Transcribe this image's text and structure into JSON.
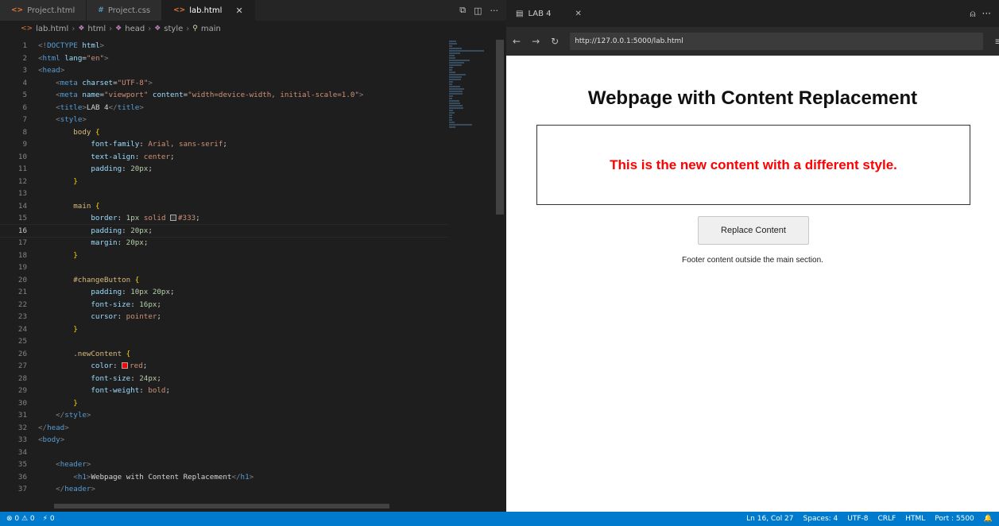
{
  "editor": {
    "tabs": [
      {
        "label": "Project.html",
        "type": "html",
        "active": false
      },
      {
        "label": "Project.css",
        "type": "css",
        "active": false
      },
      {
        "label": "lab.html",
        "type": "html",
        "active": true
      }
    ],
    "breadcrumb": [
      "lab.html",
      "html",
      "head",
      "style",
      "main"
    ],
    "current_line": 16,
    "lines": [
      [
        {
          "c": "tk-punc",
          "t": "<!"
        },
        {
          "c": "tk-tag",
          "t": "DOCTYPE"
        },
        {
          "c": "tk-attr",
          "t": " html"
        },
        {
          "c": "tk-punc",
          "t": ">"
        }
      ],
      [
        {
          "c": "tk-punc",
          "t": "<"
        },
        {
          "c": "tk-tag",
          "t": "html"
        },
        {
          "c": "tk-attr",
          "t": " lang"
        },
        {
          "c": "tk-text",
          "t": "="
        },
        {
          "c": "tk-str",
          "t": "\"en\""
        },
        {
          "c": "tk-punc",
          "t": ">"
        }
      ],
      [
        {
          "c": "tk-punc",
          "t": "<"
        },
        {
          "c": "tk-tag",
          "t": "head"
        },
        {
          "c": "tk-punc",
          "t": ">"
        }
      ],
      [
        {
          "c": "tk-text",
          "t": "    "
        },
        {
          "c": "tk-punc",
          "t": "<"
        },
        {
          "c": "tk-tag",
          "t": "meta"
        },
        {
          "c": "tk-attr",
          "t": " charset"
        },
        {
          "c": "tk-text",
          "t": "="
        },
        {
          "c": "tk-str",
          "t": "\"UTF-8\""
        },
        {
          "c": "tk-punc",
          "t": ">"
        }
      ],
      [
        {
          "c": "tk-text",
          "t": "    "
        },
        {
          "c": "tk-punc",
          "t": "<"
        },
        {
          "c": "tk-tag",
          "t": "meta"
        },
        {
          "c": "tk-attr",
          "t": " name"
        },
        {
          "c": "tk-text",
          "t": "="
        },
        {
          "c": "tk-str",
          "t": "\"viewport\""
        },
        {
          "c": "tk-attr",
          "t": " content"
        },
        {
          "c": "tk-text",
          "t": "="
        },
        {
          "c": "tk-str",
          "t": "\"width=device-width, initial-scale=1.0\""
        },
        {
          "c": "tk-punc",
          "t": ">"
        }
      ],
      [
        {
          "c": "tk-text",
          "t": "    "
        },
        {
          "c": "tk-punc",
          "t": "<"
        },
        {
          "c": "tk-tag",
          "t": "title"
        },
        {
          "c": "tk-punc",
          "t": ">"
        },
        {
          "c": "tk-text",
          "t": "LAB 4"
        },
        {
          "c": "tk-punc",
          "t": "</"
        },
        {
          "c": "tk-tag",
          "t": "title"
        },
        {
          "c": "tk-punc",
          "t": ">"
        }
      ],
      [
        {
          "c": "tk-text",
          "t": "    "
        },
        {
          "c": "tk-punc",
          "t": "<"
        },
        {
          "c": "tk-tag",
          "t": "style"
        },
        {
          "c": "tk-punc",
          "t": ">"
        }
      ],
      [
        {
          "c": "tk-text",
          "t": "        "
        },
        {
          "c": "tk-sel",
          "t": "body"
        },
        {
          "c": "tk-text",
          "t": " "
        },
        {
          "c": "tk-brace",
          "t": "{"
        }
      ],
      [
        {
          "c": "tk-text",
          "t": "            "
        },
        {
          "c": "tk-prop",
          "t": "font-family"
        },
        {
          "c": "tk-text",
          "t": ": "
        },
        {
          "c": "tk-val",
          "t": "Arial, sans-serif"
        },
        {
          "c": "tk-text",
          "t": ";"
        }
      ],
      [
        {
          "c": "tk-text",
          "t": "            "
        },
        {
          "c": "tk-prop",
          "t": "text-align"
        },
        {
          "c": "tk-text",
          "t": ": "
        },
        {
          "c": "tk-val",
          "t": "center"
        },
        {
          "c": "tk-text",
          "t": ";"
        }
      ],
      [
        {
          "c": "tk-text",
          "t": "            "
        },
        {
          "c": "tk-prop",
          "t": "padding"
        },
        {
          "c": "tk-text",
          "t": ": "
        },
        {
          "c": "tk-num",
          "t": "20px"
        },
        {
          "c": "tk-text",
          "t": ";"
        }
      ],
      [
        {
          "c": "tk-text",
          "t": "        "
        },
        {
          "c": "tk-brace",
          "t": "}"
        }
      ],
      [
        {
          "c": "tk-text",
          "t": ""
        }
      ],
      [
        {
          "c": "tk-text",
          "t": "        "
        },
        {
          "c": "tk-sel",
          "t": "main"
        },
        {
          "c": "tk-text",
          "t": " "
        },
        {
          "c": "tk-brace",
          "t": "{"
        }
      ],
      [
        {
          "c": "tk-text",
          "t": "            "
        },
        {
          "c": "tk-prop",
          "t": "border"
        },
        {
          "c": "tk-text",
          "t": ": "
        },
        {
          "c": "tk-num",
          "t": "1px"
        },
        {
          "c": "tk-val",
          "t": " solid "
        },
        {
          "c": "sw",
          "t": "#333"
        },
        {
          "c": "tk-val",
          "t": "#333"
        },
        {
          "c": "tk-text",
          "t": ";"
        }
      ],
      [
        {
          "c": "tk-text",
          "t": "            "
        },
        {
          "c": "tk-prop",
          "t": "padding"
        },
        {
          "c": "tk-text",
          "t": ": "
        },
        {
          "c": "tk-num",
          "t": "20px"
        },
        {
          "c": "tk-text",
          "t": ";"
        }
      ],
      [
        {
          "c": "tk-text",
          "t": "            "
        },
        {
          "c": "tk-prop",
          "t": "margin"
        },
        {
          "c": "tk-text",
          "t": ": "
        },
        {
          "c": "tk-num",
          "t": "20px"
        },
        {
          "c": "tk-text",
          "t": ";"
        }
      ],
      [
        {
          "c": "tk-text",
          "t": "        "
        },
        {
          "c": "tk-brace",
          "t": "}"
        }
      ],
      [
        {
          "c": "tk-text",
          "t": ""
        }
      ],
      [
        {
          "c": "tk-text",
          "t": "        "
        },
        {
          "c": "tk-sel",
          "t": "#changeButton"
        },
        {
          "c": "tk-text",
          "t": " "
        },
        {
          "c": "tk-brace",
          "t": "{"
        }
      ],
      [
        {
          "c": "tk-text",
          "t": "            "
        },
        {
          "c": "tk-prop",
          "t": "padding"
        },
        {
          "c": "tk-text",
          "t": ": "
        },
        {
          "c": "tk-num",
          "t": "10px 20px"
        },
        {
          "c": "tk-text",
          "t": ";"
        }
      ],
      [
        {
          "c": "tk-text",
          "t": "            "
        },
        {
          "c": "tk-prop",
          "t": "font-size"
        },
        {
          "c": "tk-text",
          "t": ": "
        },
        {
          "c": "tk-num",
          "t": "16px"
        },
        {
          "c": "tk-text",
          "t": ";"
        }
      ],
      [
        {
          "c": "tk-text",
          "t": "            "
        },
        {
          "c": "tk-prop",
          "t": "cursor"
        },
        {
          "c": "tk-text",
          "t": ": "
        },
        {
          "c": "tk-val",
          "t": "pointer"
        },
        {
          "c": "tk-text",
          "t": ";"
        }
      ],
      [
        {
          "c": "tk-text",
          "t": "        "
        },
        {
          "c": "tk-brace",
          "t": "}"
        }
      ],
      [
        {
          "c": "tk-text",
          "t": ""
        }
      ],
      [
        {
          "c": "tk-text",
          "t": "        "
        },
        {
          "c": "tk-sel",
          "t": ".newContent"
        },
        {
          "c": "tk-text",
          "t": " "
        },
        {
          "c": "tk-brace",
          "t": "{"
        }
      ],
      [
        {
          "c": "tk-text",
          "t": "            "
        },
        {
          "c": "tk-prop",
          "t": "color"
        },
        {
          "c": "tk-text",
          "t": ": "
        },
        {
          "c": "sw",
          "t": "#ff0000"
        },
        {
          "c": "tk-val",
          "t": "red"
        },
        {
          "c": "tk-text",
          "t": ";"
        }
      ],
      [
        {
          "c": "tk-text",
          "t": "            "
        },
        {
          "c": "tk-prop",
          "t": "font-size"
        },
        {
          "c": "tk-text",
          "t": ": "
        },
        {
          "c": "tk-num",
          "t": "24px"
        },
        {
          "c": "tk-text",
          "t": ";"
        }
      ],
      [
        {
          "c": "tk-text",
          "t": "            "
        },
        {
          "c": "tk-prop",
          "t": "font-weight"
        },
        {
          "c": "tk-text",
          "t": ": "
        },
        {
          "c": "tk-val",
          "t": "bold"
        },
        {
          "c": "tk-text",
          "t": ";"
        }
      ],
      [
        {
          "c": "tk-text",
          "t": "        "
        },
        {
          "c": "tk-brace",
          "t": "}"
        }
      ],
      [
        {
          "c": "tk-text",
          "t": "    "
        },
        {
          "c": "tk-punc",
          "t": "</"
        },
        {
          "c": "tk-tag",
          "t": "style"
        },
        {
          "c": "tk-punc",
          "t": ">"
        }
      ],
      [
        {
          "c": "tk-punc",
          "t": "</"
        },
        {
          "c": "tk-tag",
          "t": "head"
        },
        {
          "c": "tk-punc",
          "t": ">"
        }
      ],
      [
        {
          "c": "tk-punc",
          "t": "<"
        },
        {
          "c": "tk-tag",
          "t": "body"
        },
        {
          "c": "tk-punc",
          "t": ">"
        }
      ],
      [
        {
          "c": "tk-text",
          "t": ""
        }
      ],
      [
        {
          "c": "tk-text",
          "t": "    "
        },
        {
          "c": "tk-punc",
          "t": "<"
        },
        {
          "c": "tk-tag",
          "t": "header"
        },
        {
          "c": "tk-punc",
          "t": ">"
        }
      ],
      [
        {
          "c": "tk-text",
          "t": "        "
        },
        {
          "c": "tk-punc",
          "t": "<"
        },
        {
          "c": "tk-tag",
          "t": "h1"
        },
        {
          "c": "tk-punc",
          "t": ">"
        },
        {
          "c": "tk-text",
          "t": "Webpage with Content Replacement"
        },
        {
          "c": "tk-punc",
          "t": "</"
        },
        {
          "c": "tk-tag",
          "t": "h1"
        },
        {
          "c": "tk-punc",
          "t": ">"
        }
      ],
      [
        {
          "c": "tk-text",
          "t": "    "
        },
        {
          "c": "tk-punc",
          "t": "</"
        },
        {
          "c": "tk-tag",
          "t": "header"
        },
        {
          "c": "tk-punc",
          "t": ">"
        }
      ]
    ]
  },
  "browser": {
    "tab_label": "LAB 4",
    "url": "http://127.0.0.1:5000/lab.html",
    "page": {
      "heading": "Webpage with Content Replacement",
      "main_text": "This is the new content with a different style.",
      "button_label": "Replace Content",
      "footer_text": "Footer content outside the main section."
    }
  },
  "statusbar": {
    "left": [
      "⊗ 0 ⚠ 0",
      "⚡ 0"
    ],
    "position": "Ln 16, Col 27",
    "spaces": "Spaces: 4",
    "encoding": "UTF-8",
    "eol": "CRLF",
    "language": "HTML",
    "port": "Port : 5500"
  },
  "colors": {
    "accent": "#007acc",
    "content_red": "#ff0000"
  }
}
